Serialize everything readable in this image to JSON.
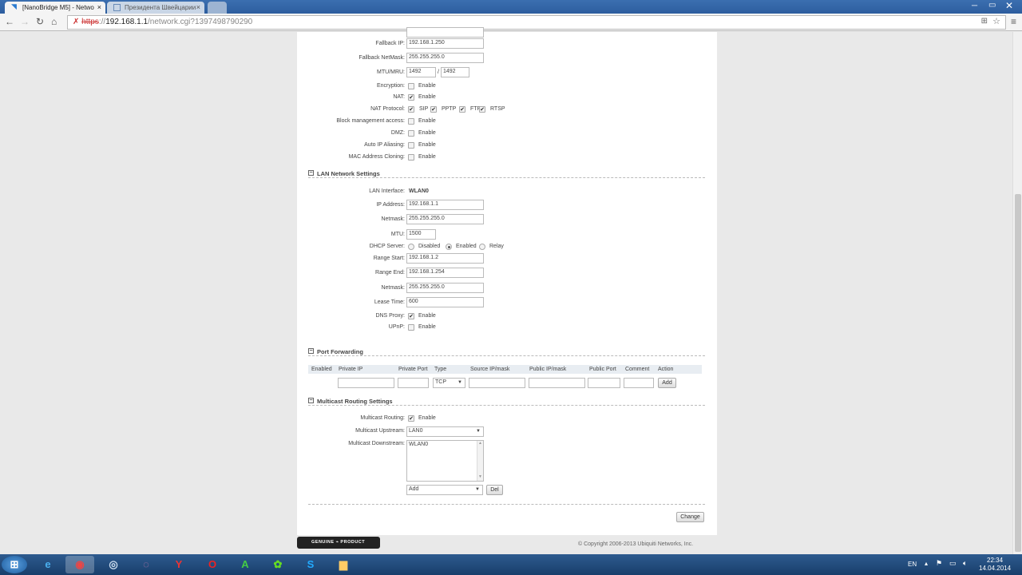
{
  "browser": {
    "tabs": [
      {
        "label": "[NanoBridge M5] - Netwo"
      },
      {
        "label": "Президента Швейцарии"
      }
    ],
    "url_scheme": "https",
    "url_host": "192.168.1.1",
    "url_path": "/network.cgi?1397498790290"
  },
  "wan": {
    "fallback_ip_label": "Fallback IP:",
    "fallback_ip": "192.168.1.250",
    "fallback_mask_label": "Fallback NetMask:",
    "fallback_mask": "255.255.255.0",
    "mtu_label": "MTU/MRU:",
    "mtu": "1492",
    "mru": "1492",
    "slash": "/",
    "enable": "Enable",
    "checks": [
      {
        "label": "Encryption:",
        "checked": false
      },
      {
        "label": "NAT:",
        "checked": true
      }
    ],
    "nat_protocol_label": "NAT Protocol:",
    "protocols": [
      {
        "label": "SIP",
        "checked": true
      },
      {
        "label": "PPTP",
        "checked": true
      },
      {
        "label": "FTP",
        "checked": true
      },
      {
        "label": "RTSP",
        "checked": true
      }
    ],
    "checks2": [
      {
        "label": "Block management access:",
        "checked": false
      },
      {
        "label": "DMZ:",
        "checked": false
      },
      {
        "label": "Auto IP Aliasing:",
        "checked": false
      },
      {
        "label": "MAC Address Cloning:",
        "checked": false
      }
    ]
  },
  "lan": {
    "title": "LAN Network Settings",
    "iface_label": "LAN Interface:",
    "iface": "WLAN0",
    "ip_label": "IP Address:",
    "ip": "192.168.1.1",
    "mask_label": "Netmask:",
    "mask": "255.255.255.0",
    "mtu_label": "MTU:",
    "mtu": "1500",
    "dhcp_label": "DHCP Server:",
    "dhcp_options": [
      "Disabled",
      "Enabled",
      "Relay"
    ],
    "dhcp_selected": "Enabled",
    "start_label": "Range Start:",
    "start": "192.168.1.2",
    "end_label": "Range End:",
    "end": "192.168.1.254",
    "mask2_label": "Netmask:",
    "mask2": "255.255.255.0",
    "lease_label": "Lease Time:",
    "lease": "600",
    "dns_label": "DNS Proxy:",
    "dns": true,
    "upnp_label": "UPnP:",
    "upnp": false,
    "enable": "Enable"
  },
  "pf": {
    "title": "Port Forwarding",
    "columns": [
      "Enabled",
      "Private IP",
      "Private Port",
      "Type",
      "Source IP/mask",
      "Public IP/mask",
      "Public Port",
      "Comment",
      "Action"
    ],
    "type": "TCP",
    "add": "Add"
  },
  "mc": {
    "title": "Multicast Routing Settings",
    "routing_label": "Multicast Routing:",
    "routing": true,
    "enable": "Enable",
    "up_label": "Multicast Upstream:",
    "up": "LAN0",
    "down_label": "Multicast Downstream:",
    "down_items": [
      "WLAN0"
    ],
    "add_select": "Add",
    "del": "Del"
  },
  "change": "Change",
  "genuine": "GENUINE ⌁ PRODUCT",
  "copyright": "© Copyright 2006-2013 Ubiquiti Networks, Inc.",
  "taskbar": {
    "lang": "EN",
    "time": "22:34",
    "date": "14.04.2014"
  }
}
